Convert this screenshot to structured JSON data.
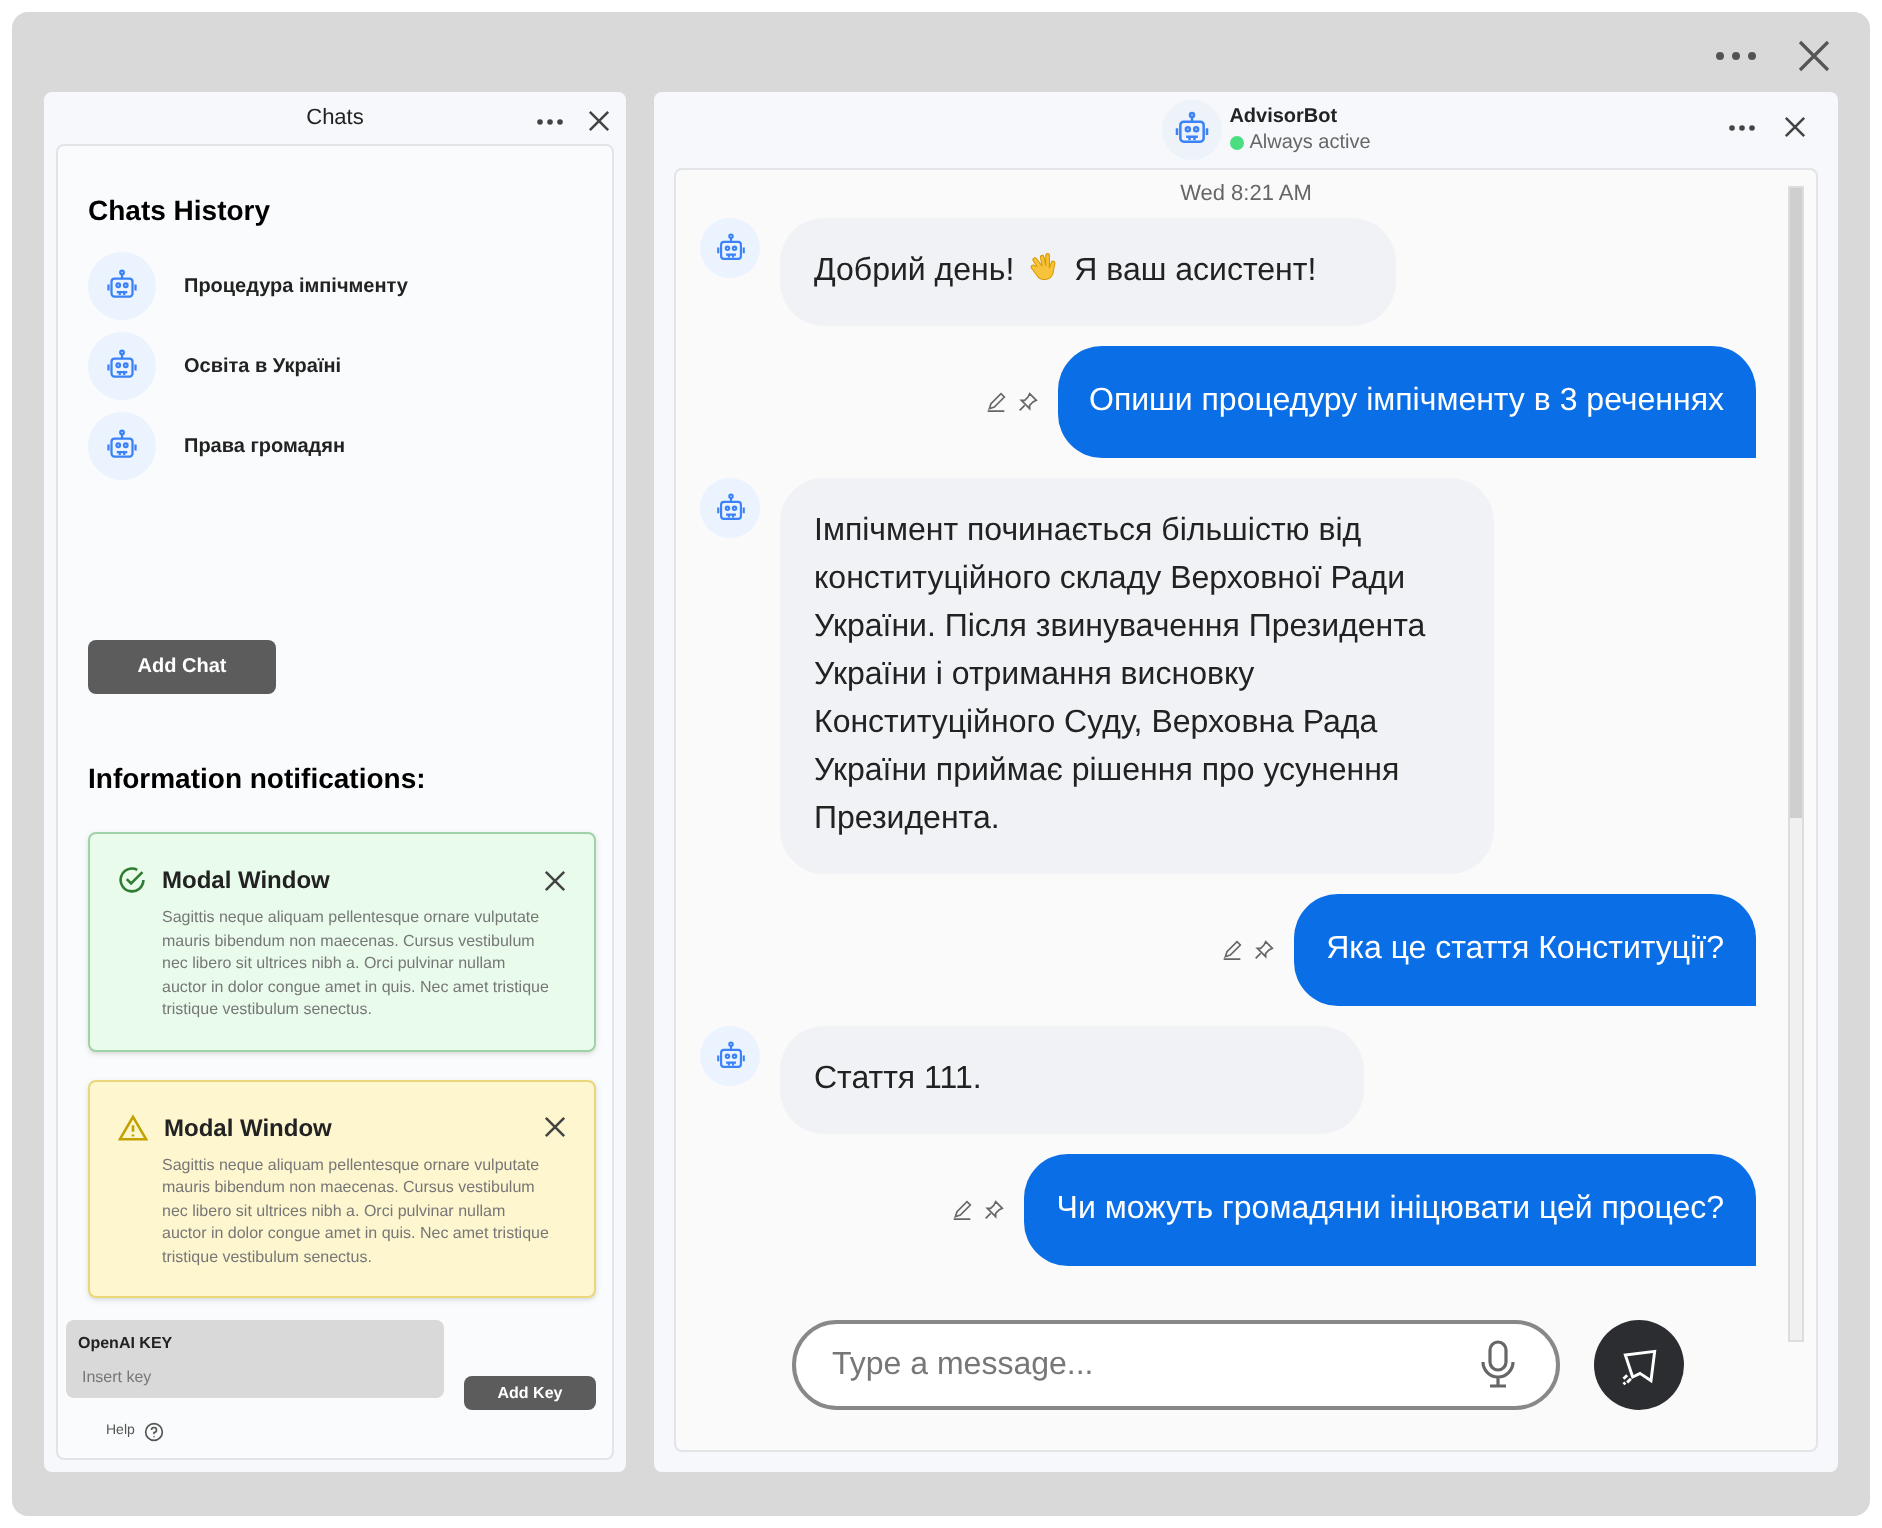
{
  "left_panel": {
    "title": "Chats",
    "history_title": "Chats History",
    "chats": [
      {
        "label": "Процедура імпічменту"
      },
      {
        "label": "Освіта в Україні"
      },
      {
        "label": "Права громадян"
      }
    ],
    "add_chat": "Add Chat",
    "notifications_title": "Information notifications:",
    "notifications": [
      {
        "kind": "success",
        "title": "Modal Window",
        "body": "Sagittis neque aliquam pellentesque ornare vulputate mauris bibendum non maecenas. Cursus vestibulum nec libero sit ultrices nibh a. Orci pulvinar nullam auctor in dolor congue amet in quis. Nec amet tristique tristique vestibulum senectus."
      },
      {
        "kind": "warning",
        "title": "Modal Window",
        "body": "Sagittis neque aliquam pellentesque ornare vulputate mauris bibendum non maecenas. Cursus vestibulum nec libero sit ultrices nibh a. Orci pulvinar nullam auctor in dolor congue amet in quis. Nec amet tristique tristique vestibulum senectus."
      }
    ],
    "key_field": {
      "label": "OpenAI KEY",
      "placeholder": "Insert key"
    },
    "add_key": "Add Key",
    "help": "Help"
  },
  "chat": {
    "bot_name": "AdvisorBot",
    "status": "Always active",
    "online": true,
    "timestamp": "Wed 8:21 AM",
    "messages": [
      {
        "kind": "bot",
        "parts": [
          "Добрий день!",
          "Я ваш асистент!"
        ]
      },
      {
        "kind": "user",
        "parts": [
          "Опиши процедуру імпічменту в 3 реченнях"
        ]
      },
      {
        "kind": "bot",
        "parts": [
          "Імпічмент починається більшістю від конституційного складу Верховної Ради України. Після звинувачення Президента України і отримання висновку Конституційного Суду, Верховна Рада України приймає рішення про усунення Президента."
        ]
      },
      {
        "kind": "user",
        "parts": [
          "Яка це стаття Конституції?"
        ]
      },
      {
        "kind": "bot",
        "parts": [
          "Стаття 111."
        ]
      },
      {
        "kind": "user",
        "parts": [
          "Чи можуть громадяни ініцювати цей процес?"
        ]
      }
    ],
    "input_placeholder": "Type a message..."
  }
}
